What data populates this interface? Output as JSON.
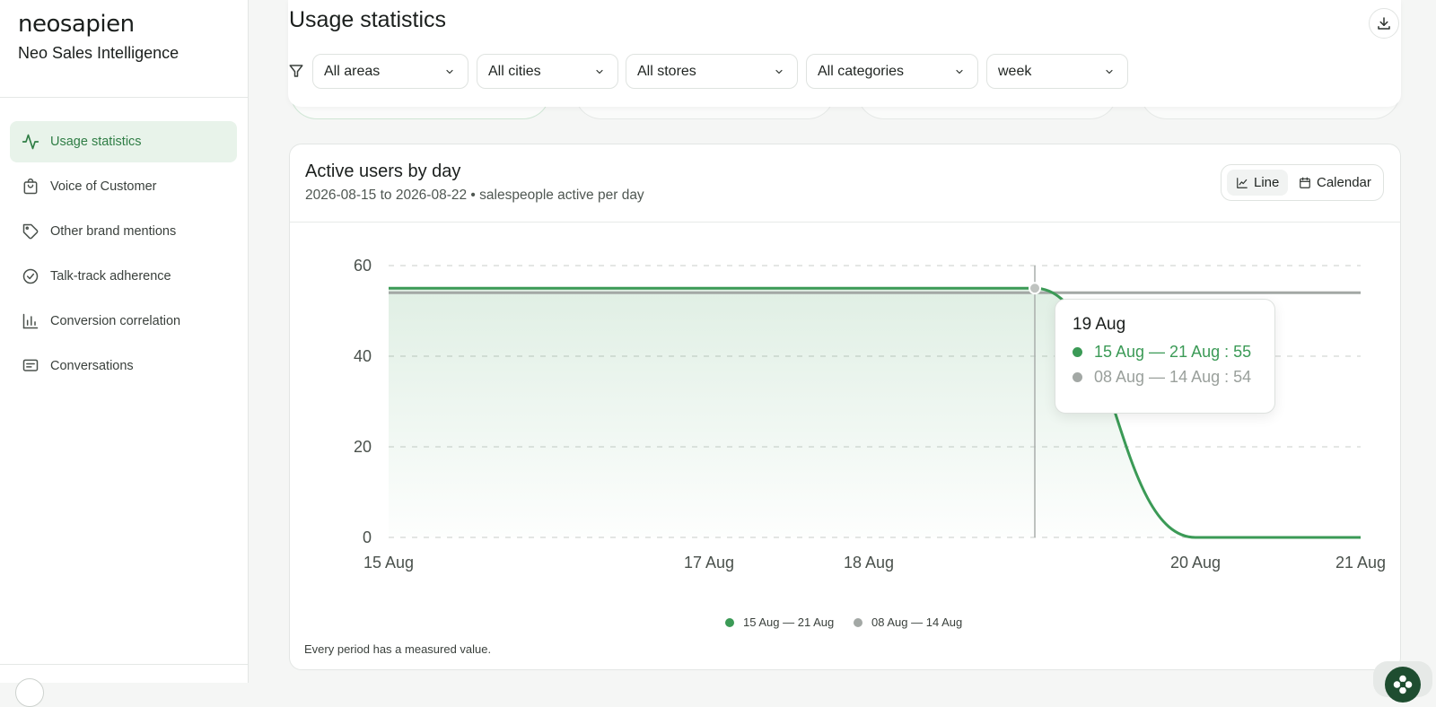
{
  "sidebar": {
    "logo": "neosapien",
    "app_name": "Neo Sales Intelligence",
    "items": [
      {
        "label": "Usage statistics",
        "icon": "activity-icon",
        "active": true
      },
      {
        "label": "Voice of Customer",
        "icon": "shopping-bag-icon",
        "active": false
      },
      {
        "label": "Other brand mentions",
        "icon": "tag-icon",
        "active": false
      },
      {
        "label": "Talk-track adherence",
        "icon": "check-circle-icon",
        "active": false
      },
      {
        "label": "Conversion correlation",
        "icon": "bar-chart-icon",
        "active": false
      },
      {
        "label": "Conversations",
        "icon": "message-square-icon",
        "active": false
      }
    ]
  },
  "header": {
    "title": "Usage statistics",
    "download_icon": "download-icon",
    "filter_icon": "filter-icon",
    "filters": [
      {
        "value": "All areas"
      },
      {
        "value": "All cities"
      },
      {
        "value": "All stores"
      },
      {
        "value": "All categories"
      },
      {
        "value": "week"
      }
    ]
  },
  "card": {
    "title": "Active users by day",
    "subtitle": "2026-08-15 to 2026-08-22 • salespeople active per day",
    "view_toggle": {
      "line": "Line",
      "calendar": "Calendar",
      "selected": "Line"
    },
    "footnote": "Every period has a measured value."
  },
  "tooltip": {
    "title": "19 Aug",
    "rows": [
      {
        "label": "15 Aug — 21 Aug : 55",
        "color": "#3b9a56"
      },
      {
        "label": "08 Aug — 14 Aug : 54",
        "color": "#a3a8a5"
      }
    ]
  },
  "chart_data": {
    "type": "line",
    "title": "Active users by day",
    "x_tick_labels": [
      "15 Aug",
      "17 Aug",
      "18 Aug",
      "20 Aug",
      "21 Aug"
    ],
    "y_ticks": [
      0,
      20,
      40,
      60
    ],
    "ylim": [
      0,
      60
    ],
    "grid": true,
    "legend_position": "bottom-center",
    "series": [
      {
        "name": "15 Aug — 21 Aug",
        "color": "#3b9a56",
        "area": true,
        "points": [
          [
            "15 Aug",
            55
          ],
          [
            "16 Aug",
            55
          ],
          [
            "17 Aug",
            55
          ],
          [
            "18 Aug",
            55
          ],
          [
            "19 Aug",
            55
          ],
          [
            "20 Aug",
            0
          ],
          [
            "21 Aug",
            0
          ]
        ]
      },
      {
        "name": "08 Aug — 14 Aug",
        "color": "#a3a8a5",
        "area": false,
        "points": [
          [
            "15 Aug",
            54
          ],
          [
            "16 Aug",
            54
          ],
          [
            "17 Aug",
            54
          ],
          [
            "18 Aug",
            54
          ],
          [
            "19 Aug",
            54
          ],
          [
            "20 Aug",
            54
          ],
          [
            "21 Aug",
            54
          ]
        ]
      }
    ],
    "hover_x": "19 Aug"
  }
}
